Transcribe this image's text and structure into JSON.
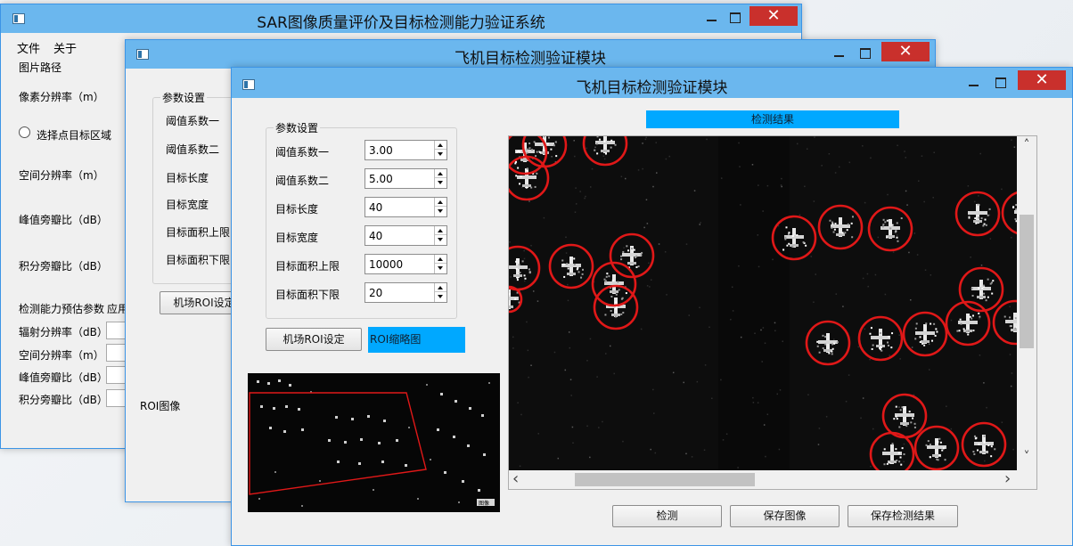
{
  "main_window": {
    "title": "SAR图像质量评价及目标检测能力验证系统",
    "menu": [
      "文件",
      "关于"
    ],
    "close_glyph": "✕",
    "labels": {
      "image_path": "图片路径",
      "pixel_res": "像素分辨率（m）",
      "select_point": "选择点目标区域",
      "spatial_res": "空间分辨率（m）",
      "pslr": "峰值旁瓣比（dB）",
      "islr": "积分旁瓣比（dB）",
      "detect_params": "检测能力预估参数",
      "apply_cut": "应用",
      "rad_res": "辐射分辨率（dB）",
      "spatial_res2": "空间分辨率（m）",
      "pslr2": "峰值旁瓣比（dB）",
      "islr2": "积分旁瓣比（dB）"
    }
  },
  "mid_window": {
    "title": "飞机目标检测验证模块",
    "close_glyph": "✕",
    "group_title": "参数设置",
    "labels": [
      "阈值系数一",
      "阈值系数二",
      "目标长度",
      "目标宽度",
      "目标面积上限",
      "目标面积下限"
    ],
    "roi_button": "机场ROI设定",
    "roi_image_label": "ROI图像"
  },
  "front_window": {
    "title": "飞机目标检测验证模块",
    "close_glyph": "✕",
    "group_title": "参数设置",
    "params": [
      {
        "label": "阈值系数一",
        "value": "3.00"
      },
      {
        "label": "阈值系数二",
        "value": "5.00"
      },
      {
        "label": "目标长度",
        "value": "40"
      },
      {
        "label": "目标宽度",
        "value": "40"
      },
      {
        "label": "目标面积上限",
        "value": "10000"
      },
      {
        "label": "目标面积下限",
        "value": "20"
      }
    ],
    "roi_button": "机场ROI设定",
    "roi_thumb_label": "ROI缩略图",
    "result_header": "检测结果",
    "thumbnail_badge": "图像",
    "buttons": {
      "detect": "检测",
      "save_image": "保存图像",
      "save_result": "保存检测结果"
    },
    "scroll": {
      "left_glyph": "‹",
      "right_glyph": "›",
      "up_glyph": "˄",
      "down_glyph": "˅"
    },
    "colors": {
      "titlebar": "#6bb7ee",
      "close": "#c9302c",
      "label_blue": "#00a8ff",
      "circle": "#e01818"
    }
  }
}
